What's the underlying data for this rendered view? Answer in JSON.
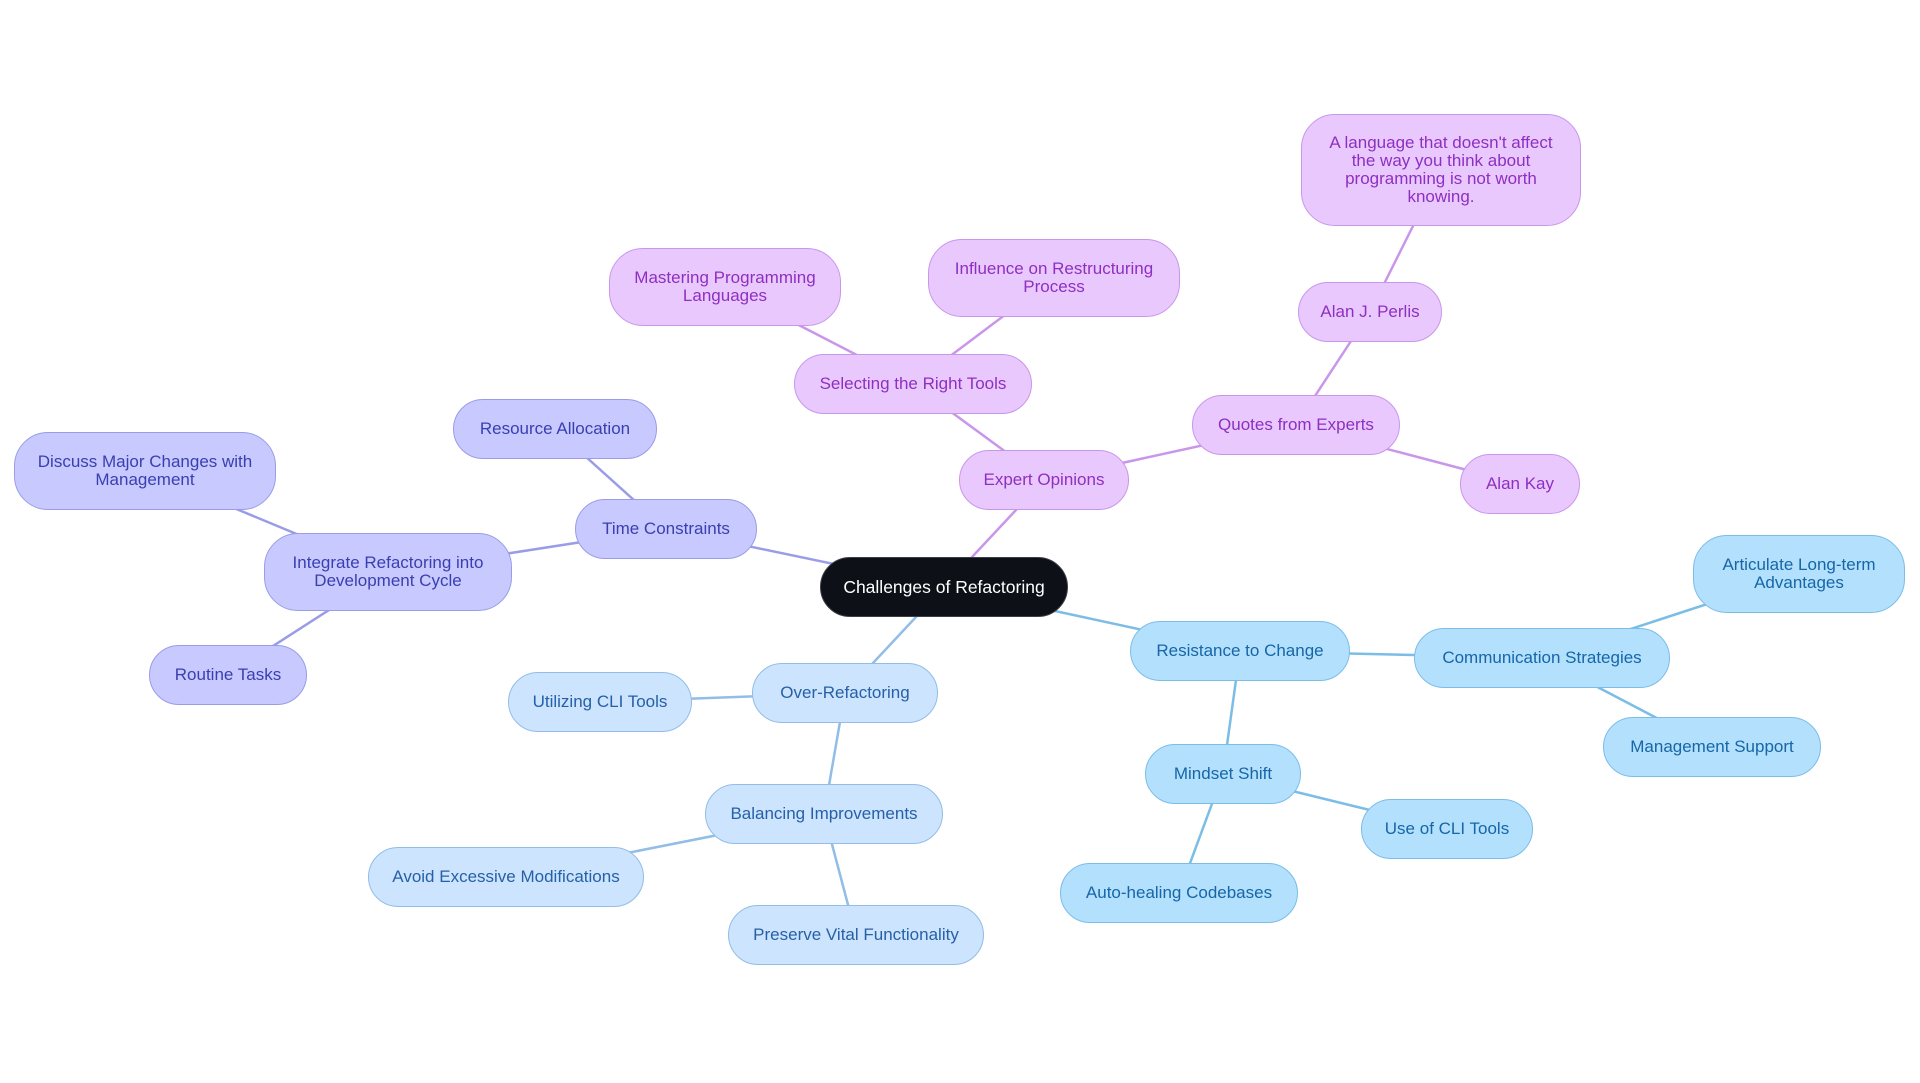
{
  "diagram": {
    "type": "mindmap",
    "root": {
      "id": "root",
      "label": "Challenges of Refactoring"
    },
    "colors": {
      "root_bg": "#0d1117",
      "indigo_branch": "#c7c9ff",
      "purple_branch": "#e9c9fd",
      "sky_branch": "#b3e0fd",
      "pale_branch": "#cce4fd"
    },
    "nodes": [
      {
        "id": "time",
        "label": "Time Constraints",
        "parent": "root",
        "branch": "indigo"
      },
      {
        "id": "resource",
        "label": "Resource Allocation",
        "parent": "time",
        "branch": "indigo"
      },
      {
        "id": "integrate",
        "label": "Integrate Refactoring into Development Cycle",
        "parent": "time",
        "branch": "indigo"
      },
      {
        "id": "discuss",
        "label": "Discuss Major Changes with Management",
        "parent": "integrate",
        "branch": "indigo"
      },
      {
        "id": "routine",
        "label": "Routine Tasks",
        "parent": "integrate",
        "branch": "indigo"
      },
      {
        "id": "expert",
        "label": "Expert Opinions",
        "parent": "root",
        "branch": "purple"
      },
      {
        "id": "selecting",
        "label": "Selecting the Right Tools",
        "parent": "expert",
        "branch": "purple"
      },
      {
        "id": "mastering",
        "label": "Mastering Programming Languages",
        "parent": "selecting",
        "branch": "purple"
      },
      {
        "id": "influence",
        "label": "Influence on Restructuring Process",
        "parent": "selecting",
        "branch": "purple"
      },
      {
        "id": "quotes",
        "label": "Quotes from Experts",
        "parent": "expert",
        "branch": "purple"
      },
      {
        "id": "perlis",
        "label": "Alan J. Perlis",
        "parent": "quotes",
        "branch": "purple"
      },
      {
        "id": "quote",
        "label": "A language that doesn't affect the way you think about programming is not worth knowing.",
        "parent": "perlis",
        "branch": "purple"
      },
      {
        "id": "kay",
        "label": "Alan Kay",
        "parent": "quotes",
        "branch": "purple"
      },
      {
        "id": "resistance",
        "label": "Resistance to Change",
        "parent": "root",
        "branch": "sky"
      },
      {
        "id": "communication",
        "label": "Communication Strategies",
        "parent": "resistance",
        "branch": "sky"
      },
      {
        "id": "articulate",
        "label": "Articulate Long-term Advantages",
        "parent": "communication",
        "branch": "sky"
      },
      {
        "id": "management",
        "label": "Management Support",
        "parent": "communication",
        "branch": "sky"
      },
      {
        "id": "mindset",
        "label": "Mindset Shift",
        "parent": "resistance",
        "branch": "sky"
      },
      {
        "id": "cliuse",
        "label": "Use of CLI Tools",
        "parent": "mindset",
        "branch": "sky"
      },
      {
        "id": "autoheal",
        "label": "Auto-healing Codebases",
        "parent": "mindset",
        "branch": "sky"
      },
      {
        "id": "over",
        "label": "Over-Refactoring",
        "parent": "root",
        "branch": "pale"
      },
      {
        "id": "utilizing",
        "label": "Utilizing CLI Tools",
        "parent": "over",
        "branch": "pale"
      },
      {
        "id": "balancing",
        "label": "Balancing Improvements",
        "parent": "over",
        "branch": "pale"
      },
      {
        "id": "avoid",
        "label": "Avoid Excessive Modifications",
        "parent": "balancing",
        "branch": "pale"
      },
      {
        "id": "preserve",
        "label": "Preserve Vital Functionality",
        "parent": "balancing",
        "branch": "pale"
      }
    ]
  }
}
